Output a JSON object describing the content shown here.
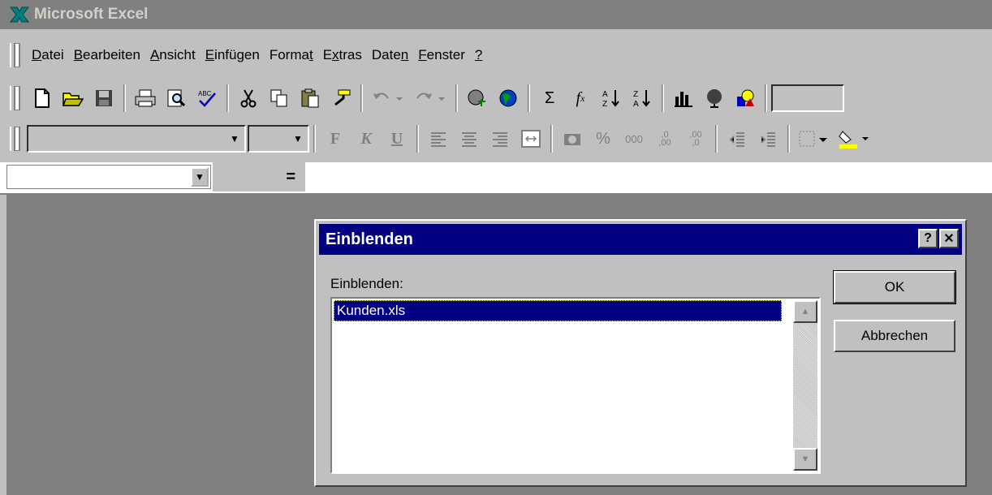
{
  "window": {
    "title": "Microsoft Excel",
    "app_icon": "excel-x-icon"
  },
  "menu": [
    {
      "label": "Datei",
      "accel": "D"
    },
    {
      "label": "Bearbeiten",
      "accel": "B"
    },
    {
      "label": "Ansicht",
      "accel": "A"
    },
    {
      "label": "Einfügen",
      "accel": "E"
    },
    {
      "label": "Format",
      "accel": "t"
    },
    {
      "label": "Extras",
      "accel": "x"
    },
    {
      "label": "Daten",
      "accel": "n"
    },
    {
      "label": "Fenster",
      "accel": "F"
    },
    {
      "label": "?",
      "accel": "?"
    }
  ],
  "formula_bar": {
    "equals": "="
  },
  "dialog": {
    "title": "Einblenden",
    "help_button": "?",
    "close_button": "✕",
    "list_label": "Einblenden:",
    "items": [
      "Kunden.xls"
    ],
    "selected_index": 0,
    "ok_label": "OK",
    "cancel_label": "Abbrechen"
  },
  "colors": {
    "title_active": "#000080",
    "title_inactive": "#808080",
    "face": "#c0c0c0",
    "workspace": "#808080"
  }
}
